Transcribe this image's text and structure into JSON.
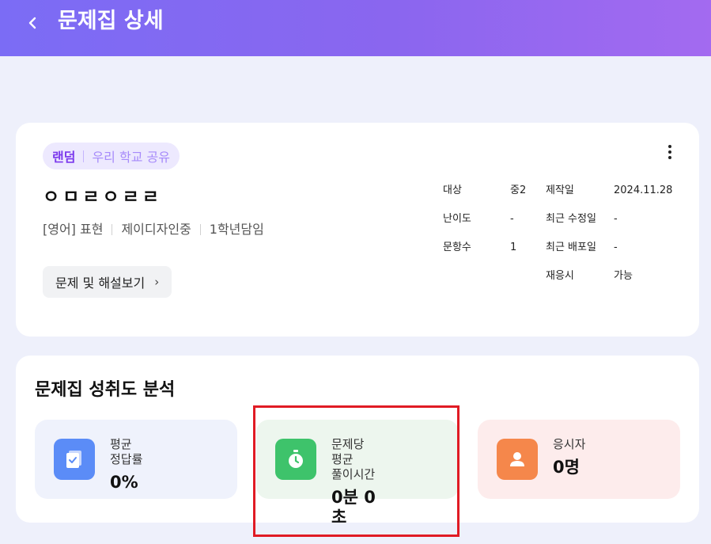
{
  "header": {
    "title": "문제집 상세",
    "back_icon": "chevron-left-icon"
  },
  "set": {
    "tag_primary": "랜덤",
    "tag_secondary": "우리 학교 공유",
    "title": "ㅇㅁㄹㅇㄹㄹ",
    "meta": [
      "[영어] 표현",
      "제이디자인중",
      "1학년담임"
    ],
    "view_button": "문제 및 해설보기",
    "view_chevron": "›",
    "details": {
      "target_label": "대상",
      "target_value": "중2",
      "difficulty_label": "난이도",
      "difficulty_value": "-",
      "count_label": "문항수",
      "count_value": "1",
      "created_label": "제작일",
      "created_value": "2024.11.28",
      "modified_label": "최근 수정일",
      "modified_value": "-",
      "distributed_label": "최근 배포일",
      "distributed_value": "-",
      "retake_label": "재응시",
      "retake_value": "가능"
    }
  },
  "stats": {
    "title": "문제집 성취도 분석",
    "tiles": [
      {
        "label": "평균 정답률",
        "value": "0%",
        "icon": "document-check-icon",
        "color": "#5b8cf7"
      },
      {
        "label": "문제당 평균 풀이시간",
        "value": "0분 0초",
        "icon": "stopwatch-icon",
        "color": "#3ec36b"
      },
      {
        "label": "응시자",
        "value": "0명",
        "icon": "person-icon",
        "color": "#f5874b"
      }
    ]
  },
  "colors": {
    "header_start": "#7b6cf5",
    "header_end": "#a36af0",
    "accent": "#7c3aed",
    "highlight": "#e01b24"
  }
}
